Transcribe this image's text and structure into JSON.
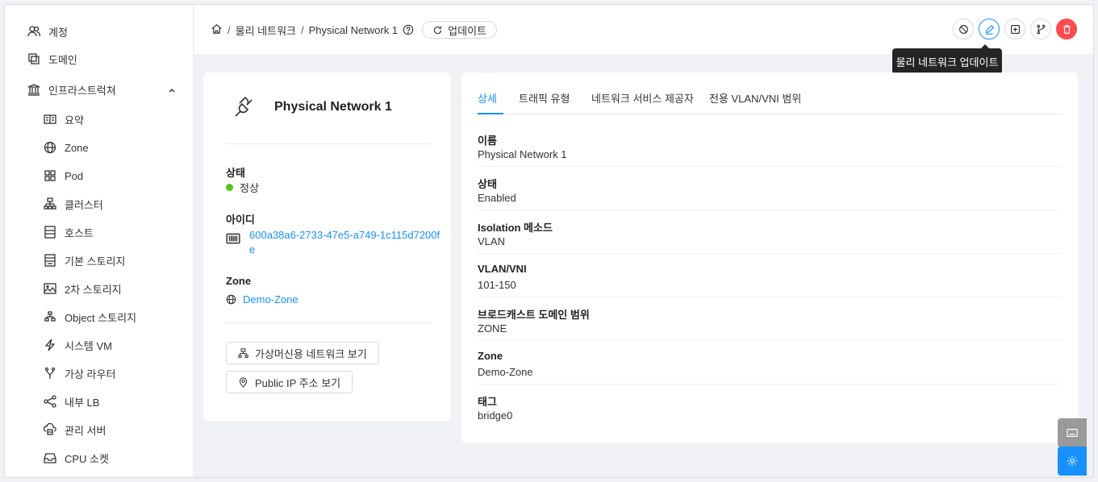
{
  "sidebar": {
    "items": [
      {
        "label": "계정",
        "icon": "user-group-icon"
      },
      {
        "label": "도메인",
        "icon": "block-icon"
      },
      {
        "label": "인프라스트럭쳐",
        "icon": "bank-icon"
      }
    ],
    "sub_items": [
      {
        "label": "요약",
        "icon": "read-icon"
      },
      {
        "label": "Zone",
        "icon": "global-icon"
      },
      {
        "label": "Pod",
        "icon": "appstore-icon"
      },
      {
        "label": "클러스터",
        "icon": "cluster-icon"
      },
      {
        "label": "호스트",
        "icon": "database-icon"
      },
      {
        "label": "기본 스토리지",
        "icon": "hdd-icon"
      },
      {
        "label": "2차 스토리지",
        "icon": "picture-icon"
      },
      {
        "label": "Object 스토리지",
        "icon": "gold-icon"
      },
      {
        "label": "시스템 VM",
        "icon": "thunderbolt-icon"
      },
      {
        "label": "가상 라우터",
        "icon": "fork-icon"
      },
      {
        "label": "내부 LB",
        "icon": "share-icon"
      },
      {
        "label": "관리 서버",
        "icon": "cloud-server-icon"
      },
      {
        "label": "CPU 소켓",
        "icon": "inbox-icon"
      }
    ]
  },
  "header": {
    "breadcrumb": [
      "물리 네트워크",
      "Physical Network 1"
    ],
    "refresh_label": "업데이트",
    "tooltip": "물리 네트워크 업데이트"
  },
  "resource": {
    "name": "Physical Network 1",
    "status_label": "상태",
    "status_value": "정상",
    "status_color": "#52c41a",
    "id_label": "아이디",
    "id_value_line1": "600a38a6-2733-47e5-a749-1c115d7200f",
    "id_value_line2": "e",
    "zone_label": "Zone",
    "zone_value": "Demo-Zone",
    "btn_guest_networks": "가상머신용 네트워크 보기",
    "btn_public_ips": "Public IP 주소 보기"
  },
  "tabs": [
    "상세",
    "트래픽 유형",
    "네트워크 서비스 제공자",
    "전용 VLAN/VNI 범위"
  ],
  "details": [
    {
      "label": "이름",
      "value": "Physical Network 1"
    },
    {
      "label": "상태",
      "value": "Enabled"
    },
    {
      "label": "Isolation 메소드",
      "value": "VLAN"
    },
    {
      "label": "VLAN/VNI",
      "value": "101-150"
    },
    {
      "label": "브로드캐스트 도메인 범위",
      "value": "ZONE"
    },
    {
      "label": "Zone",
      "value": "Demo-Zone"
    },
    {
      "label": "태그",
      "value": "bridge0"
    }
  ],
  "colors": {
    "accent": "#1890ff",
    "danger": "#ff4d4f",
    "success": "#52c41a"
  }
}
